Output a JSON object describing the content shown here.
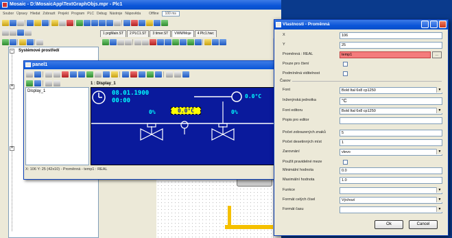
{
  "main_window": {
    "title": "Mosaic - D:\\MosaicApp\\TextGraphObjs.mpr - Plc1",
    "menu": [
      "Soubor",
      "Úpravy",
      "Hledat",
      "Zobrazit",
      "Projekt",
      "Program",
      "PLC",
      "Debug",
      "Nástroje",
      "Nápověda"
    ],
    "zoom": "100 ms",
    "mode": "Offline",
    "tabs": [
      "1 prgMain.ST",
      "2 PLC1.ST",
      "3 timer.ST",
      "VWM/Moje",
      "4 Plc1.hwc"
    ],
    "tree_title": "Systémové prostředí"
  },
  "panel1": {
    "title": "panel1",
    "doc_title": "1 : Display_1",
    "list_items": [
      "Display_1"
    ],
    "status": "X: 106 Y: 25 (42x10) - Proměnná - temp1 : REAL",
    "hmi": {
      "date": "08.01.1900",
      "time": "00:00",
      "value_left": "0%",
      "value_center": "0.0°C",
      "value_right": "0%",
      "value_temp": "0.0°C"
    }
  },
  "props_dialog": {
    "title": "Vlastnosti - Proměnná",
    "fields": [
      {
        "label": "X",
        "value": "106"
      },
      {
        "label": "Y",
        "value": "25"
      },
      {
        "label": "Proměnná : REAL",
        "value": "temp1"
      },
      {
        "label": "Pouze pro čtení",
        "checkbox": true
      },
      {
        "label": "Podmíněná viditelnost",
        "checkbox": true
      }
    ],
    "group_label": "Časov",
    "rows": [
      {
        "label": "Font",
        "value": "Bold Ital 6x8 cp1250",
        "type": "dropdown"
      },
      {
        "label": "Inženýrská jednotka",
        "value": "°C",
        "type": "text"
      },
      {
        "label": "Font editoru",
        "value": "Bold Ital 6x8 cp1250",
        "type": "dropdown"
      },
      {
        "label": "Popis pro editor",
        "value": "",
        "type": "text"
      },
      {
        "label": "Počet zobrazených znaků",
        "value": "5",
        "type": "text"
      },
      {
        "label": "Počet desetinných míst",
        "value": "1",
        "type": "text"
      },
      {
        "label": "Zarovnání",
        "value": "vlevo",
        "type": "dropdown"
      },
      {
        "label": "Použít pravidelné meze",
        "value": "",
        "type": "checkbox"
      },
      {
        "label": "Minimální hodnota",
        "value": "0.0",
        "type": "text"
      },
      {
        "label": "Maximální hodnota",
        "value": "1.0",
        "type": "text"
      },
      {
        "label": "Funkce",
        "value": "",
        "type": "dropdown"
      },
      {
        "label": "Formát celých čísel",
        "value": "Výchozí",
        "type": "dropdown"
      },
      {
        "label": "Formát času",
        "value": "",
        "type": "dropdown"
      }
    ],
    "ok_label": "Ok",
    "cancel_label": "Cancel"
  },
  "colors": {
    "titlebar_blue": "#0a55d8",
    "hmi_background": "#0a1a9c",
    "hmi_cyan": "#00ffff",
    "hmi_yellow": "#ffff00",
    "field_error": "#f47c7c",
    "pipe_yellow": "#f5c000"
  }
}
